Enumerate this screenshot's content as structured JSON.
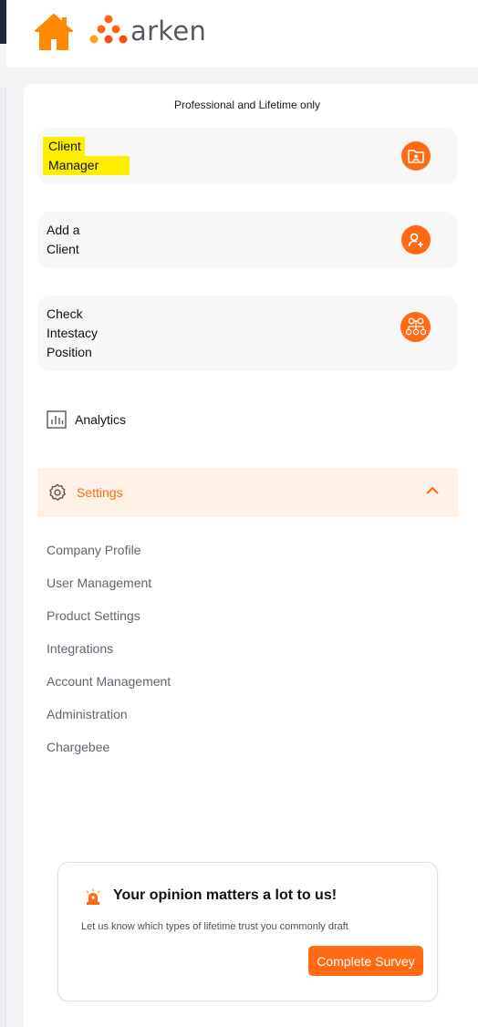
{
  "header": {
    "logo_text": "arken"
  },
  "plan_note": "Professional and Lifetime only",
  "cards": [
    {
      "lines": [
        "Client",
        "Manager"
      ],
      "icon": "client-folder-icon"
    },
    {
      "lines": [
        "Add a",
        "Client"
      ],
      "icon": "add-user-icon"
    },
    {
      "lines": [
        "Check",
        "Intestacy",
        "Position"
      ],
      "icon": "family-tree-icon"
    }
  ],
  "nav": {
    "analytics": "Analytics",
    "settings": "Settings",
    "settings_items": [
      "Company Profile",
      "User Management",
      "Product Settings",
      "Integrations",
      "Account Management",
      "Administration",
      "Chargebee"
    ]
  },
  "survey": {
    "title": "Your opinion matters a lot to us!",
    "subtitle": "Let us know which types of lifetime trust you commonly draft",
    "button": "Complete Survey"
  },
  "colors": {
    "accent": "#ff6a13",
    "highlight": "#ffee00",
    "settings_bg": "#fff1e6"
  }
}
